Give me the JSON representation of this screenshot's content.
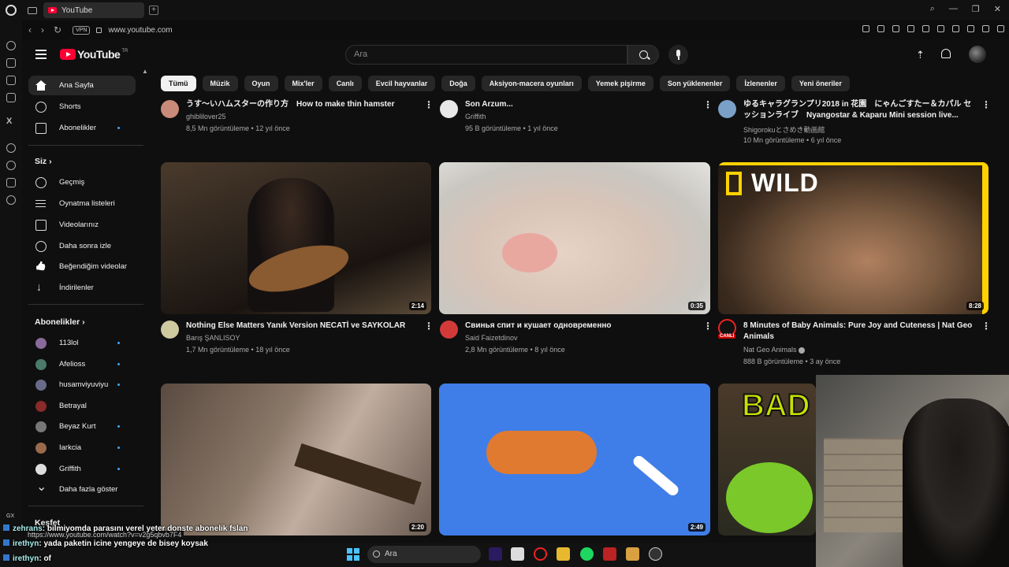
{
  "browser": {
    "tab_title": "YouTube",
    "url": "www.youtube.com",
    "vpn_label": "VPN"
  },
  "header": {
    "logo_text": "YouTube",
    "logo_sup": "TR",
    "search_placeholder": "Ara"
  },
  "sidebar": {
    "main": [
      {
        "label": "Ana Sayfa",
        "icon": "home-icon"
      },
      {
        "label": "Shorts",
        "icon": "shorts-icon"
      },
      {
        "label": "Abonelikler",
        "icon": "subscriptions-icon"
      }
    ],
    "you_heading": "Siz",
    "you": [
      {
        "label": "Geçmiş",
        "icon": "history-icon"
      },
      {
        "label": "Oynatma listeleri",
        "icon": "playlists-icon"
      },
      {
        "label": "Videolarınız",
        "icon": "your-videos-icon"
      },
      {
        "label": "Daha sonra izle",
        "icon": "watch-later-icon"
      },
      {
        "label": "Beğendiğim videolar",
        "icon": "liked-videos-icon"
      },
      {
        "label": "İndirilenler",
        "icon": "downloads-icon"
      }
    ],
    "subs_heading": "Abonelikler",
    "subs": [
      {
        "label": "113lol",
        "color": "#8a6a9a",
        "dot": true
      },
      {
        "label": "Afelioss",
        "color": "#4a7a6a",
        "dot": true
      },
      {
        "label": "husamviyuviyu",
        "color": "#6a6a8a",
        "dot": true
      },
      {
        "label": "Betrayal",
        "color": "#8a2a2a",
        "dot": false
      },
      {
        "label": "Beyaz Kurt",
        "color": "#777777",
        "dot": true
      },
      {
        "label": "Iarkcia",
        "color": "#9a6a4a",
        "dot": true
      },
      {
        "label": "Griffith",
        "color": "#dddddd",
        "dot": true
      }
    ],
    "show_more": "Daha fazla göster",
    "explore_heading": "Keşfet"
  },
  "chips": [
    "Tümü",
    "Müzik",
    "Oyun",
    "Mix'ler",
    "Canlı",
    "Evcil hayvanlar",
    "Doğa",
    "Aksiyon-macera oyunları",
    "Yemek pişirme",
    "Son yüklenenler",
    "İzlenenler",
    "Yeni öneriler"
  ],
  "videos_row0": [
    {
      "title": "うす〜いハムスターの作り方　How to make thin hamster",
      "channel": "ghiblilover25",
      "stats": "8,5 Mn görüntüleme • 12 yıl önce",
      "avatar": "#c98a7a"
    },
    {
      "title": "Son Arzum...",
      "channel": "Griffith",
      "stats": "95 B görüntüleme • 1 yıl önce",
      "avatar": "#e8e8e8"
    },
    {
      "title": "ゆるキャラグランプリ2018 in 花園　にゃんごすたー＆カパル セッションライブ　Nyangostar & Kaparu Mini session live...",
      "channel": "Shigorokuとさめき動画館",
      "stats": "10 Mn görüntüleme • 6 yıl önce",
      "avatar": "#7aa0c8"
    }
  ],
  "videos_row1": [
    {
      "title": "Nothing Else Matters Yanık Version NECATİ ve SAYKOLAR",
      "channel": "Barış ŞANLISOY",
      "stats": "1,7 Mn görüntüleme • 18 yıl önce",
      "duration": "2:14",
      "avatar": "#cfc9a0"
    },
    {
      "title": "Свинья спит и кушает одновременно",
      "channel": "Said Faizetdinov",
      "stats": "2,8 Mn görüntüleme • 8 yıl önce",
      "duration": "0:35",
      "avatar": "#d23a3a"
    },
    {
      "title": "8 Minutes of Baby Animals: Pure Joy and Cuteness | Nat Geo Animals",
      "channel": "Nat Geo Animals",
      "stats": "888 B görüntüleme • 3 ay önce",
      "duration": "8:28",
      "avatar": "#111111",
      "live_badge": "CANLI",
      "thumb_brand": "WILD"
    }
  ],
  "videos_row2": [
    {
      "duration": "2:20"
    },
    {
      "duration": "2:49"
    },
    {
      "thumb_text": "BAD"
    }
  ],
  "overlay": {
    "gx_label": "GX",
    "status_url": "https://www.youtube.com/watch?v=v2g5qbvb7F4",
    "chat": [
      {
        "name": "zehrans",
        "msg": ": bilmiyomda parasını verel yeter donste abonelik fslan"
      },
      {
        "name": "irethyn",
        "msg": ": yada paketin icine yengeye de bisey koysak"
      },
      {
        "name": "irethyn",
        "msg": ": of"
      }
    ]
  },
  "taskbar": {
    "search_label": "Ara"
  }
}
